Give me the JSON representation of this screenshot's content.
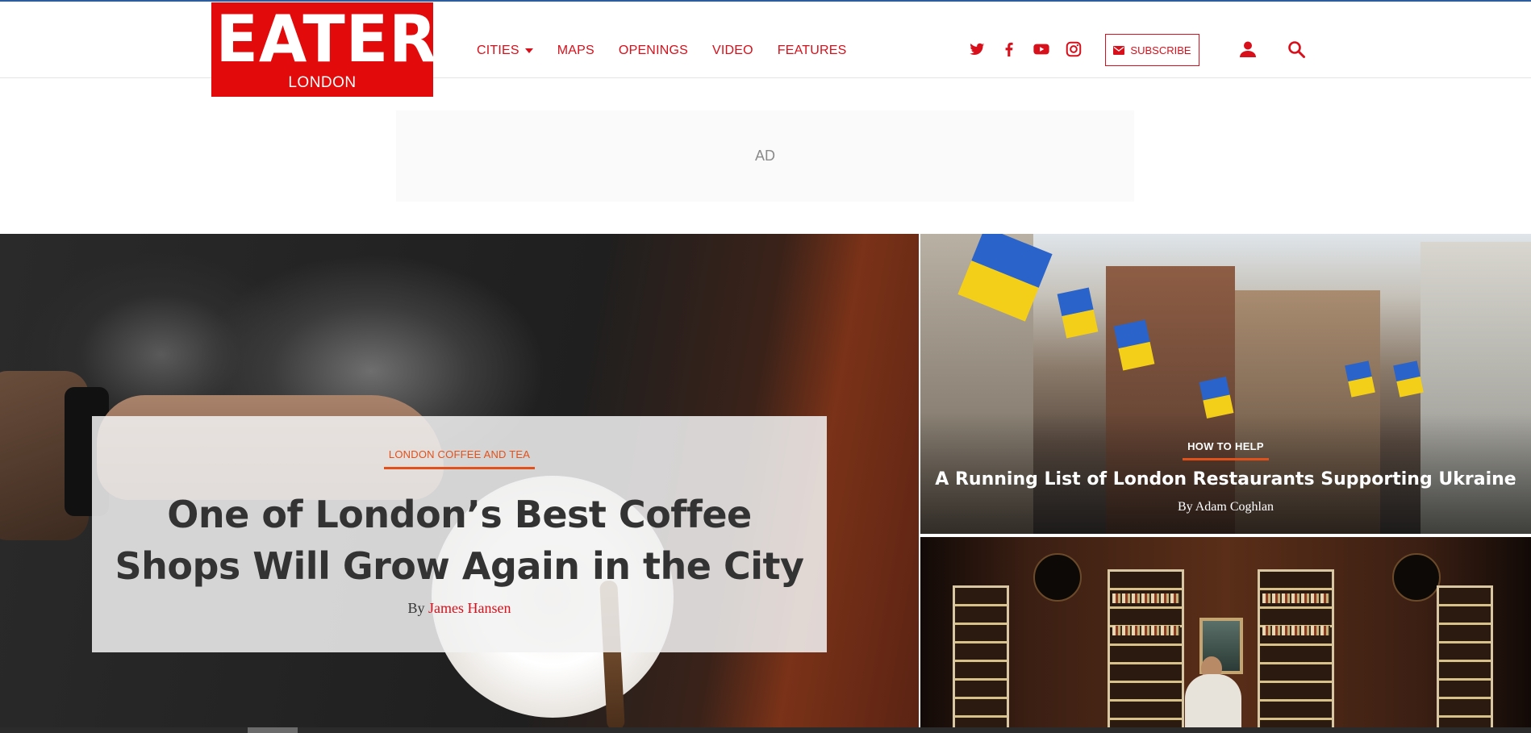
{
  "header": {
    "logo": {
      "word": "EATER",
      "city": "LONDON"
    },
    "nav": [
      {
        "label": "CITIES",
        "has_dropdown": true
      },
      {
        "label": "MAPS"
      },
      {
        "label": "OPENINGS"
      },
      {
        "label": "VIDEO"
      },
      {
        "label": "FEATURES"
      }
    ],
    "social_icons": [
      "twitter-icon",
      "facebook-icon",
      "youtube-icon",
      "instagram-icon"
    ],
    "subscribe_label": "SUBSCRIBE",
    "icons": {
      "account": "user-icon",
      "search": "search-icon",
      "subscribe": "envelope-icon"
    }
  },
  "ad": {
    "label": "AD"
  },
  "hero": {
    "kicker": "LONDON COFFEE AND TEA",
    "title": "One of London’s Best Coffee Shops Will Grow Again in the City",
    "byline_prefix": "By",
    "author": "James Hansen"
  },
  "side_story_1": {
    "kicker": "HOW TO HELP",
    "title": "A Running List of London Restaurants Supporting Ukraine",
    "byline": "By Adam Coghlan"
  },
  "colors": {
    "brand_red": "#e20a0a",
    "link_red": "#d7101b",
    "kicker_orange": "#e2511b",
    "top_rule_blue": "#2e5d9e"
  }
}
